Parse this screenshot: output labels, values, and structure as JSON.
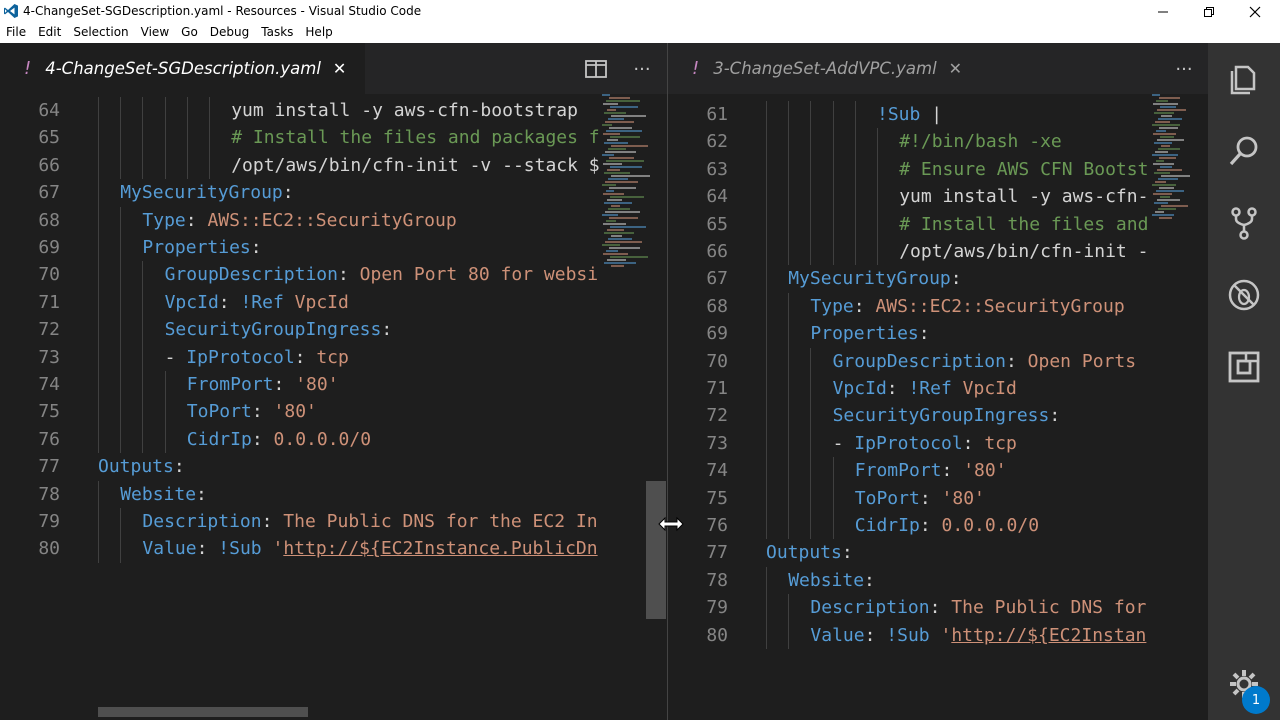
{
  "window": {
    "title": "4-ChangeSet-SGDescription.yaml - Resources - Visual Studio Code"
  },
  "menu": [
    "File",
    "Edit",
    "Selection",
    "View",
    "Go",
    "Debug",
    "Tasks",
    "Help"
  ],
  "left_group": {
    "tab": {
      "marker": "!",
      "label": "4-ChangeSet-SGDescription.yaml",
      "close": "✕"
    },
    "actions": {
      "split": "split-editor-icon",
      "more": "···"
    },
    "lines": [
      {
        "n": "64",
        "indent": 6,
        "parts": [
          [
            "p",
            "yum install -y aws-cfn-bootstrap"
          ]
        ]
      },
      {
        "n": "65",
        "indent": 6,
        "parts": [
          [
            "c",
            "# Install the files and packages f"
          ]
        ]
      },
      {
        "n": "66",
        "indent": 6,
        "parts": [
          [
            "p",
            "/opt/aws/bin/cfn-init -v --stack $"
          ]
        ]
      },
      {
        "n": "67",
        "indent": 1,
        "parts": [
          [
            "k",
            "MySecurityGroup"
          ],
          [
            "p",
            ":"
          ]
        ]
      },
      {
        "n": "68",
        "indent": 2,
        "parts": [
          [
            "k",
            "Type"
          ],
          [
            "p",
            ": "
          ],
          [
            "v",
            "AWS::EC2::SecurityGroup"
          ]
        ]
      },
      {
        "n": "69",
        "indent": 2,
        "parts": [
          [
            "k",
            "Properties"
          ],
          [
            "p",
            ":"
          ]
        ]
      },
      {
        "n": "70",
        "indent": 3,
        "parts": [
          [
            "k",
            "GroupDescription"
          ],
          [
            "p",
            ": "
          ],
          [
            "v",
            "Open Port 80 for websi"
          ]
        ]
      },
      {
        "n": "71",
        "indent": 3,
        "parts": [
          [
            "k",
            "VpcId"
          ],
          [
            "p",
            ": "
          ],
          [
            "tag",
            "!Ref"
          ],
          [
            "v",
            " VpcId"
          ]
        ]
      },
      {
        "n": "72",
        "indent": 3,
        "parts": [
          [
            "k",
            "SecurityGroupIngress"
          ],
          [
            "p",
            ":"
          ]
        ]
      },
      {
        "n": "73",
        "indent": 3,
        "parts": [
          [
            "p",
            "- "
          ],
          [
            "k",
            "IpProtocol"
          ],
          [
            "p",
            ": "
          ],
          [
            "v",
            "tcp"
          ]
        ]
      },
      {
        "n": "74",
        "indent": 4,
        "parts": [
          [
            "k",
            "FromPort"
          ],
          [
            "p",
            ": "
          ],
          [
            "v",
            "'80'"
          ]
        ]
      },
      {
        "n": "75",
        "indent": 4,
        "parts": [
          [
            "k",
            "ToPort"
          ],
          [
            "p",
            ": "
          ],
          [
            "v",
            "'80'"
          ]
        ]
      },
      {
        "n": "76",
        "indent": 4,
        "parts": [
          [
            "k",
            "CidrIp"
          ],
          [
            "p",
            ": "
          ],
          [
            "v",
            "0.0.0.0/0"
          ]
        ]
      },
      {
        "n": "77",
        "indent": 0,
        "parts": [
          [
            "k",
            "Outputs"
          ],
          [
            "p",
            ":"
          ]
        ]
      },
      {
        "n": "78",
        "indent": 1,
        "parts": [
          [
            "k",
            "Website"
          ],
          [
            "p",
            ":"
          ]
        ]
      },
      {
        "n": "79",
        "indent": 2,
        "parts": [
          [
            "k",
            "Description"
          ],
          [
            "p",
            ": "
          ],
          [
            "v",
            "The Public DNS for the EC2 In"
          ]
        ]
      },
      {
        "n": "80",
        "indent": 2,
        "parts": [
          [
            "k",
            "Value"
          ],
          [
            "p",
            ": "
          ],
          [
            "tag",
            "!Sub"
          ],
          [
            "v",
            " '"
          ],
          [
            "u",
            "http://${EC2Instance.PublicDn"
          ]
        ]
      }
    ]
  },
  "right_group": {
    "tab": {
      "marker": "!",
      "label": "3-ChangeSet-AddVPC.yaml",
      "close": "✕"
    },
    "actions": {
      "more": "···"
    },
    "lines": [
      {
        "n": "61",
        "indent": 5,
        "parts": [
          [
            "tag",
            "!Sub"
          ],
          [
            "p",
            " |"
          ]
        ]
      },
      {
        "n": "62",
        "indent": 6,
        "parts": [
          [
            "c",
            "#!/bin/bash -xe"
          ]
        ]
      },
      {
        "n": "63",
        "indent": 6,
        "parts": [
          [
            "c",
            "# Ensure AWS CFN Bootst"
          ]
        ]
      },
      {
        "n": "64",
        "indent": 6,
        "parts": [
          [
            "p",
            "yum install -y aws-cfn-"
          ]
        ]
      },
      {
        "n": "65",
        "indent": 6,
        "parts": [
          [
            "c",
            "# Install the files and"
          ]
        ]
      },
      {
        "n": "66",
        "indent": 6,
        "parts": [
          [
            "p",
            "/opt/aws/bin/cfn-init -"
          ]
        ]
      },
      {
        "n": "67",
        "indent": 1,
        "parts": [
          [
            "k",
            "MySecurityGroup"
          ],
          [
            "p",
            ":"
          ]
        ]
      },
      {
        "n": "68",
        "indent": 2,
        "parts": [
          [
            "k",
            "Type"
          ],
          [
            "p",
            ": "
          ],
          [
            "v",
            "AWS::EC2::SecurityGroup"
          ]
        ]
      },
      {
        "n": "69",
        "indent": 2,
        "parts": [
          [
            "k",
            "Properties"
          ],
          [
            "p",
            ":"
          ]
        ]
      },
      {
        "n": "70",
        "indent": 3,
        "parts": [
          [
            "k",
            "GroupDescription"
          ],
          [
            "p",
            ": "
          ],
          [
            "v",
            "Open Ports"
          ]
        ]
      },
      {
        "n": "71",
        "indent": 3,
        "parts": [
          [
            "k",
            "VpcId"
          ],
          [
            "p",
            ": "
          ],
          [
            "tag",
            "!Ref"
          ],
          [
            "v",
            " VpcId"
          ]
        ]
      },
      {
        "n": "72",
        "indent": 3,
        "parts": [
          [
            "k",
            "SecurityGroupIngress"
          ],
          [
            "p",
            ":"
          ]
        ]
      },
      {
        "n": "73",
        "indent": 3,
        "parts": [
          [
            "p",
            "- "
          ],
          [
            "k",
            "IpProtocol"
          ],
          [
            "p",
            ": "
          ],
          [
            "v",
            "tcp"
          ]
        ]
      },
      {
        "n": "74",
        "indent": 4,
        "parts": [
          [
            "k",
            "FromPort"
          ],
          [
            "p",
            ": "
          ],
          [
            "v",
            "'80'"
          ]
        ]
      },
      {
        "n": "75",
        "indent": 4,
        "parts": [
          [
            "k",
            "ToPort"
          ],
          [
            "p",
            ": "
          ],
          [
            "v",
            "'80'"
          ]
        ]
      },
      {
        "n": "76",
        "indent": 4,
        "parts": [
          [
            "k",
            "CidrIp"
          ],
          [
            "p",
            ": "
          ],
          [
            "v",
            "0.0.0.0/0"
          ]
        ]
      },
      {
        "n": "77",
        "indent": 0,
        "parts": [
          [
            "k",
            "Outputs"
          ],
          [
            "p",
            ":"
          ]
        ]
      },
      {
        "n": "78",
        "indent": 1,
        "parts": [
          [
            "k",
            "Website"
          ],
          [
            "p",
            ":"
          ]
        ]
      },
      {
        "n": "79",
        "indent": 2,
        "parts": [
          [
            "k",
            "Description"
          ],
          [
            "p",
            ": "
          ],
          [
            "v",
            "The Public DNS for"
          ]
        ]
      },
      {
        "n": "80",
        "indent": 2,
        "parts": [
          [
            "k",
            "Value"
          ],
          [
            "p",
            ": "
          ],
          [
            "tag",
            "!Sub"
          ],
          [
            "v",
            " '"
          ],
          [
            "u",
            "http://${EC2Instan"
          ]
        ]
      }
    ]
  },
  "activity_bar": {
    "icons": [
      "explorer-icon",
      "search-icon",
      "source-control-icon",
      "debug-icon",
      "extensions-icon"
    ],
    "settings_icon": "gear-icon",
    "badge": "1"
  },
  "colors": {
    "editor_bg": "#1e1e1e",
    "key": "#569cd6",
    "string": "#ce9178",
    "comment": "#6a9955",
    "accent": "#007acc"
  }
}
